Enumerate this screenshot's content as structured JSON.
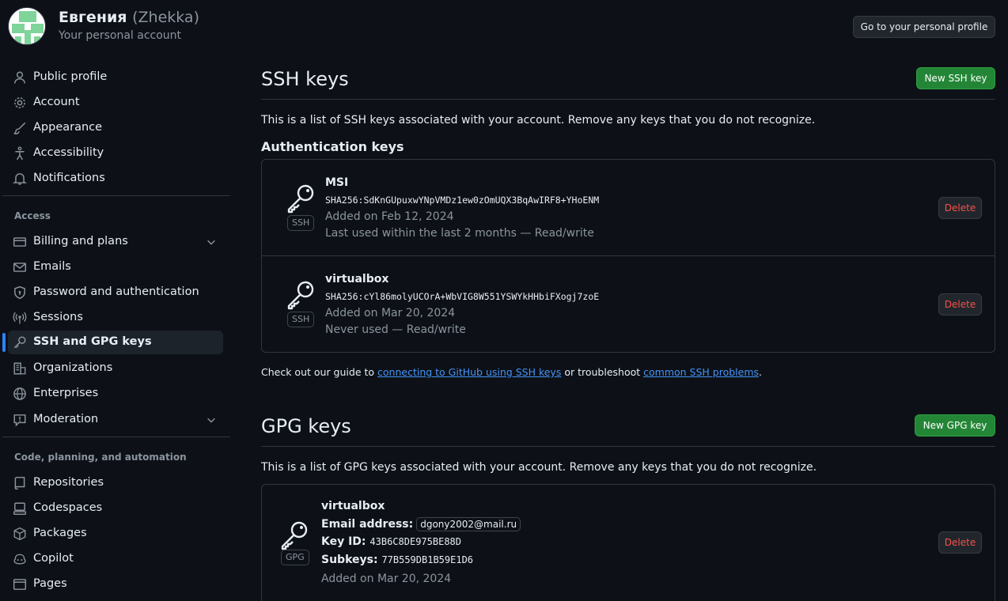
{
  "header": {
    "name": "Евгения",
    "login": "(Zhekka)",
    "subtitle": "Your personal account",
    "profile_button": "Go to your personal profile"
  },
  "sidebar": {
    "items_top": [
      {
        "label": "Public profile",
        "icon": "person-icon"
      },
      {
        "label": "Account",
        "icon": "gear-icon"
      },
      {
        "label": "Appearance",
        "icon": "paintbrush-icon"
      },
      {
        "label": "Accessibility",
        "icon": "accessibility-icon"
      },
      {
        "label": "Notifications",
        "icon": "bell-icon"
      }
    ],
    "access_heading": "Access",
    "items_access": [
      {
        "label": "Billing and plans",
        "icon": "credit-card-icon",
        "expandable": true
      },
      {
        "label": "Emails",
        "icon": "mail-icon"
      },
      {
        "label": "Password and authentication",
        "icon": "shield-lock-icon"
      },
      {
        "label": "Sessions",
        "icon": "broadcast-icon"
      },
      {
        "label": "SSH and GPG keys",
        "icon": "key-icon",
        "active": true
      },
      {
        "label": "Organizations",
        "icon": "organization-icon"
      },
      {
        "label": "Enterprises",
        "icon": "globe-icon"
      },
      {
        "label": "Moderation",
        "icon": "report-icon",
        "expandable": true
      }
    ],
    "code_heading": "Code, planning, and automation",
    "items_code": [
      {
        "label": "Repositories",
        "icon": "repo-icon"
      },
      {
        "label": "Codespaces",
        "icon": "codespaces-icon"
      },
      {
        "label": "Packages",
        "icon": "package-icon"
      },
      {
        "label": "Copilot",
        "icon": "copilot-icon"
      },
      {
        "label": "Pages",
        "icon": "browser-icon"
      }
    ]
  },
  "ssh": {
    "title": "SSH keys",
    "new_button": "New SSH key",
    "description": "This is a list of SSH keys associated with your account. Remove any keys that you do not recognize.",
    "subheading": "Authentication keys",
    "keys": [
      {
        "name": "MSI",
        "fingerprint": "SHA256:SdKnGUpuxwYNpVMDz1ew0zOmUQX3BqAwIRF8+YHoENM",
        "added": "Added on Feb 12, 2024",
        "usage": "Last used within the last 2 months — Read/write",
        "tag": "SSH",
        "delete_label": "Delete"
      },
      {
        "name": "virtualbox",
        "fingerprint": "SHA256:cYl86molyUCOrA+WbVIG8W551YSWYkHHbiFXogj7zoE",
        "added": "Added on Mar 20, 2024",
        "usage": "Never used — Read/write",
        "tag": "SSH",
        "delete_label": "Delete"
      }
    ],
    "guide": {
      "prefix": "Check out our guide to ",
      "link1": "connecting to GitHub using SSH keys",
      "middle": " or troubleshoot ",
      "link2": "common SSH problems",
      "suffix": "."
    }
  },
  "gpg": {
    "title": "GPG keys",
    "new_button": "New GPG key",
    "description": "This is a list of GPG keys associated with your account. Remove any keys that you do not recognize.",
    "keys": [
      {
        "name": "virtualbox",
        "email_label": "Email address:",
        "email": "dgony2002@mail.ru",
        "keyid_label": "Key ID:",
        "keyid": "43B6C8DE975BE88D",
        "subkeys_label": "Subkeys:",
        "subkeys": "77B559DB1B59E1D6",
        "added": "Added on Mar 20, 2024",
        "tag": "GPG",
        "delete_label": "Delete"
      }
    ]
  },
  "colors": {
    "background": "#0d1117",
    "primary_button": "#238636",
    "danger_text": "#f85149",
    "link": "#4493f8",
    "active_indicator": "#2f81f7"
  }
}
